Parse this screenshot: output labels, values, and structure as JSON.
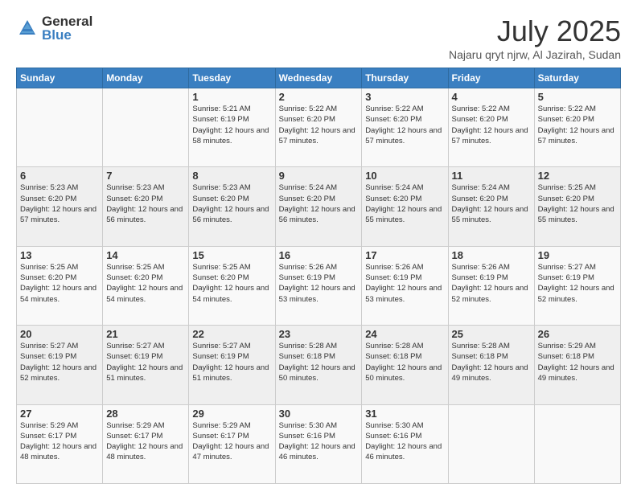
{
  "logo": {
    "general": "General",
    "blue": "Blue"
  },
  "header": {
    "month": "July 2025",
    "location": "Najaru qryt njrw, Al Jazirah, Sudan"
  },
  "weekdays": [
    "Sunday",
    "Monday",
    "Tuesday",
    "Wednesday",
    "Thursday",
    "Friday",
    "Saturday"
  ],
  "weeks": [
    [
      {
        "day": "",
        "sunrise": "",
        "sunset": "",
        "daylight": ""
      },
      {
        "day": "",
        "sunrise": "",
        "sunset": "",
        "daylight": ""
      },
      {
        "day": "1",
        "sunrise": "Sunrise: 5:21 AM",
        "sunset": "Sunset: 6:19 PM",
        "daylight": "Daylight: 12 hours and 58 minutes."
      },
      {
        "day": "2",
        "sunrise": "Sunrise: 5:22 AM",
        "sunset": "Sunset: 6:20 PM",
        "daylight": "Daylight: 12 hours and 57 minutes."
      },
      {
        "day": "3",
        "sunrise": "Sunrise: 5:22 AM",
        "sunset": "Sunset: 6:20 PM",
        "daylight": "Daylight: 12 hours and 57 minutes."
      },
      {
        "day": "4",
        "sunrise": "Sunrise: 5:22 AM",
        "sunset": "Sunset: 6:20 PM",
        "daylight": "Daylight: 12 hours and 57 minutes."
      },
      {
        "day": "5",
        "sunrise": "Sunrise: 5:22 AM",
        "sunset": "Sunset: 6:20 PM",
        "daylight": "Daylight: 12 hours and 57 minutes."
      }
    ],
    [
      {
        "day": "6",
        "sunrise": "Sunrise: 5:23 AM",
        "sunset": "Sunset: 6:20 PM",
        "daylight": "Daylight: 12 hours and 57 minutes."
      },
      {
        "day": "7",
        "sunrise": "Sunrise: 5:23 AM",
        "sunset": "Sunset: 6:20 PM",
        "daylight": "Daylight: 12 hours and 56 minutes."
      },
      {
        "day": "8",
        "sunrise": "Sunrise: 5:23 AM",
        "sunset": "Sunset: 6:20 PM",
        "daylight": "Daylight: 12 hours and 56 minutes."
      },
      {
        "day": "9",
        "sunrise": "Sunrise: 5:24 AM",
        "sunset": "Sunset: 6:20 PM",
        "daylight": "Daylight: 12 hours and 56 minutes."
      },
      {
        "day": "10",
        "sunrise": "Sunrise: 5:24 AM",
        "sunset": "Sunset: 6:20 PM",
        "daylight": "Daylight: 12 hours and 55 minutes."
      },
      {
        "day": "11",
        "sunrise": "Sunrise: 5:24 AM",
        "sunset": "Sunset: 6:20 PM",
        "daylight": "Daylight: 12 hours and 55 minutes."
      },
      {
        "day": "12",
        "sunrise": "Sunrise: 5:25 AM",
        "sunset": "Sunset: 6:20 PM",
        "daylight": "Daylight: 12 hours and 55 minutes."
      }
    ],
    [
      {
        "day": "13",
        "sunrise": "Sunrise: 5:25 AM",
        "sunset": "Sunset: 6:20 PM",
        "daylight": "Daylight: 12 hours and 54 minutes."
      },
      {
        "day": "14",
        "sunrise": "Sunrise: 5:25 AM",
        "sunset": "Sunset: 6:20 PM",
        "daylight": "Daylight: 12 hours and 54 minutes."
      },
      {
        "day": "15",
        "sunrise": "Sunrise: 5:25 AM",
        "sunset": "Sunset: 6:20 PM",
        "daylight": "Daylight: 12 hours and 54 minutes."
      },
      {
        "day": "16",
        "sunrise": "Sunrise: 5:26 AM",
        "sunset": "Sunset: 6:19 PM",
        "daylight": "Daylight: 12 hours and 53 minutes."
      },
      {
        "day": "17",
        "sunrise": "Sunrise: 5:26 AM",
        "sunset": "Sunset: 6:19 PM",
        "daylight": "Daylight: 12 hours and 53 minutes."
      },
      {
        "day": "18",
        "sunrise": "Sunrise: 5:26 AM",
        "sunset": "Sunset: 6:19 PM",
        "daylight": "Daylight: 12 hours and 52 minutes."
      },
      {
        "day": "19",
        "sunrise": "Sunrise: 5:27 AM",
        "sunset": "Sunset: 6:19 PM",
        "daylight": "Daylight: 12 hours and 52 minutes."
      }
    ],
    [
      {
        "day": "20",
        "sunrise": "Sunrise: 5:27 AM",
        "sunset": "Sunset: 6:19 PM",
        "daylight": "Daylight: 12 hours and 52 minutes."
      },
      {
        "day": "21",
        "sunrise": "Sunrise: 5:27 AM",
        "sunset": "Sunset: 6:19 PM",
        "daylight": "Daylight: 12 hours and 51 minutes."
      },
      {
        "day": "22",
        "sunrise": "Sunrise: 5:27 AM",
        "sunset": "Sunset: 6:19 PM",
        "daylight": "Daylight: 12 hours and 51 minutes."
      },
      {
        "day": "23",
        "sunrise": "Sunrise: 5:28 AM",
        "sunset": "Sunset: 6:18 PM",
        "daylight": "Daylight: 12 hours and 50 minutes."
      },
      {
        "day": "24",
        "sunrise": "Sunrise: 5:28 AM",
        "sunset": "Sunset: 6:18 PM",
        "daylight": "Daylight: 12 hours and 50 minutes."
      },
      {
        "day": "25",
        "sunrise": "Sunrise: 5:28 AM",
        "sunset": "Sunset: 6:18 PM",
        "daylight": "Daylight: 12 hours and 49 minutes."
      },
      {
        "day": "26",
        "sunrise": "Sunrise: 5:29 AM",
        "sunset": "Sunset: 6:18 PM",
        "daylight": "Daylight: 12 hours and 49 minutes."
      }
    ],
    [
      {
        "day": "27",
        "sunrise": "Sunrise: 5:29 AM",
        "sunset": "Sunset: 6:17 PM",
        "daylight": "Daylight: 12 hours and 48 minutes."
      },
      {
        "day": "28",
        "sunrise": "Sunrise: 5:29 AM",
        "sunset": "Sunset: 6:17 PM",
        "daylight": "Daylight: 12 hours and 48 minutes."
      },
      {
        "day": "29",
        "sunrise": "Sunrise: 5:29 AM",
        "sunset": "Sunset: 6:17 PM",
        "daylight": "Daylight: 12 hours and 47 minutes."
      },
      {
        "day": "30",
        "sunrise": "Sunrise: 5:30 AM",
        "sunset": "Sunset: 6:16 PM",
        "daylight": "Daylight: 12 hours and 46 minutes."
      },
      {
        "day": "31",
        "sunrise": "Sunrise: 5:30 AM",
        "sunset": "Sunset: 6:16 PM",
        "daylight": "Daylight: 12 hours and 46 minutes."
      },
      {
        "day": "",
        "sunrise": "",
        "sunset": "",
        "daylight": ""
      },
      {
        "day": "",
        "sunrise": "",
        "sunset": "",
        "daylight": ""
      }
    ]
  ]
}
